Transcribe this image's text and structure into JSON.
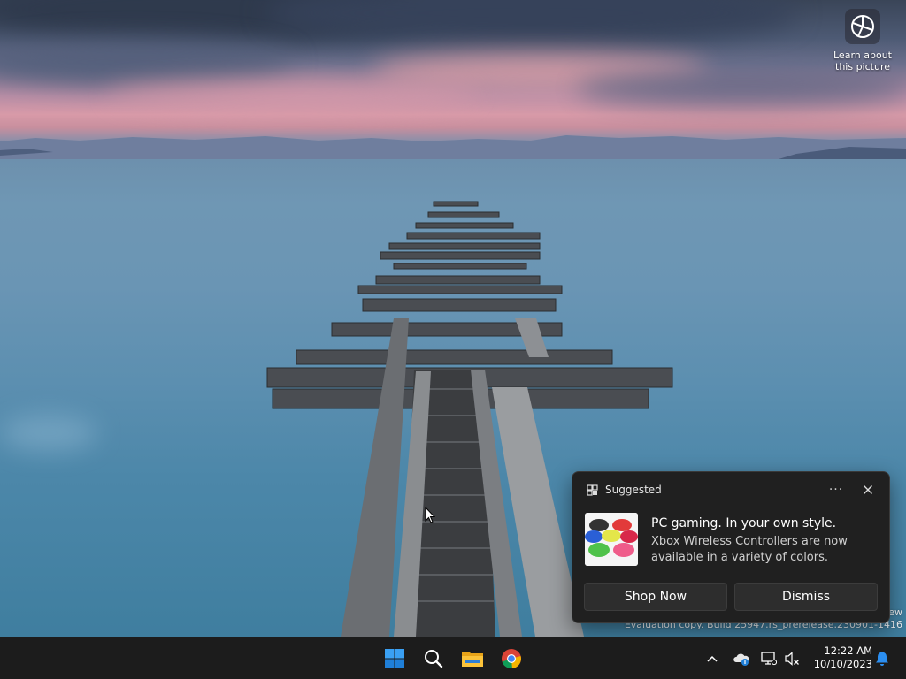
{
  "desktop": {
    "learn_about": {
      "label_line1": "Learn about",
      "label_line2": "this picture",
      "icon": "camera-icon"
    },
    "watermark": {
      "line1": "ew",
      "line2": "Evaluation copy. Build 25947.rs_prerelease.230901-1416"
    }
  },
  "notification": {
    "header": "Suggested",
    "header_icon": "widgets-icon",
    "more_label": "···",
    "title": "PC gaming. In your own style.",
    "body": "Xbox Wireless Controllers are now available in a variety of colors.",
    "thumbnail": "xbox-controllers-image",
    "primary_button": "Shop Now",
    "secondary_button": "Dismiss"
  },
  "taskbar": {
    "apps": [
      {
        "name": "start",
        "icon": "windows-logo-icon"
      },
      {
        "name": "search",
        "icon": "search-icon"
      },
      {
        "name": "file-explorer",
        "icon": "folder-icon"
      },
      {
        "name": "chrome",
        "icon": "chrome-icon"
      }
    ],
    "tray": {
      "overflow_icon": "chevron-up-icon",
      "onedrive_icon": "cloud-icon",
      "network_icon": "network-icon",
      "volume_icon": "volume-muted-icon",
      "notifications_icon": "bell-icon"
    },
    "clock": {
      "time": "12:22 AM",
      "date": "10/10/2023"
    }
  },
  "colors": {
    "accent": "#0078d4",
    "taskbar": "#1c1c1c",
    "toast_bg": "#202020"
  }
}
